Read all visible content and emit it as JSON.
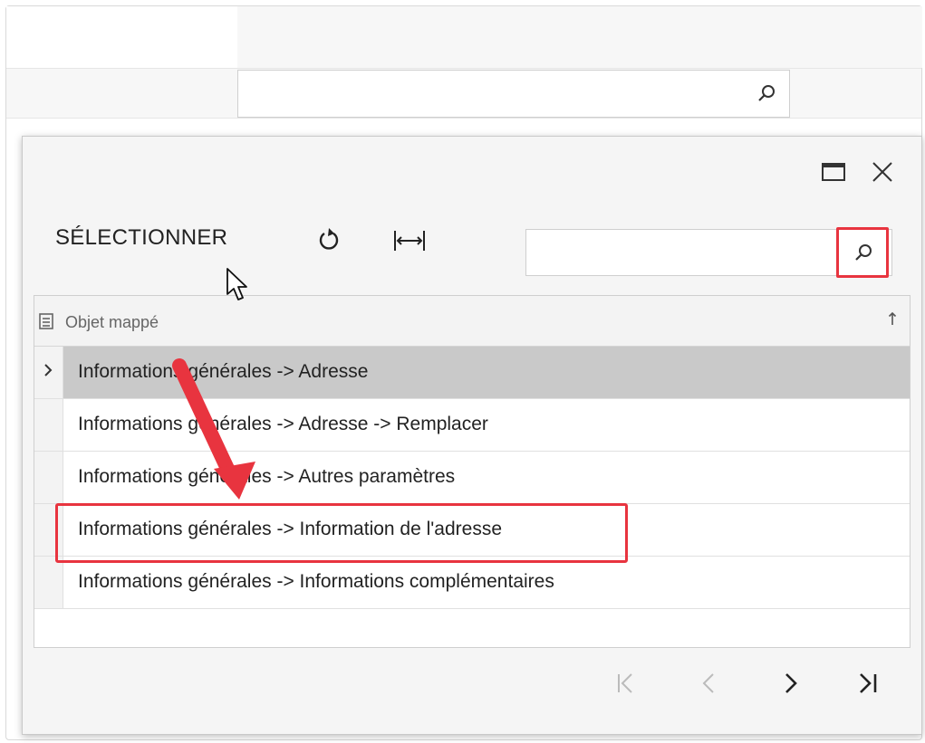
{
  "background": {
    "search_placeholder": ""
  },
  "dialog": {
    "toolbar": {
      "select_label": "SÉLECTIONNER",
      "search_placeholder": ""
    },
    "grid": {
      "column_header": "Objet mappé",
      "rows": [
        {
          "label": "Informations générales -> Adresse",
          "active": true
        },
        {
          "label": "Informations générales -> Adresse -> Remplacer",
          "active": false
        },
        {
          "label": "Informations générales -> Autres paramètres",
          "active": false
        },
        {
          "label": "Informations générales -> Information de l'adresse",
          "active": false
        },
        {
          "label": "Informations générales -> Informations complémentaires",
          "active": false
        }
      ]
    },
    "pager": {
      "first_glyph": "|<",
      "prev_glyph": "<",
      "next_glyph": ">",
      "last_glyph": ">|"
    }
  },
  "colors": {
    "highlight": "#e8343f",
    "active_row": "#c9c9c9",
    "dialog_bg": "#f5f5f5"
  },
  "icons": {
    "background_search": "search-icon",
    "maximize": "maximize-icon",
    "close": "close-icon",
    "refresh": "refresh-icon",
    "fit_columns": "fit-columns-icon",
    "toolbar_search": "search-icon",
    "column_settings": "column-settings-icon",
    "sort": "sort-up-icon",
    "row_indicator": "chevron-right-icon"
  }
}
